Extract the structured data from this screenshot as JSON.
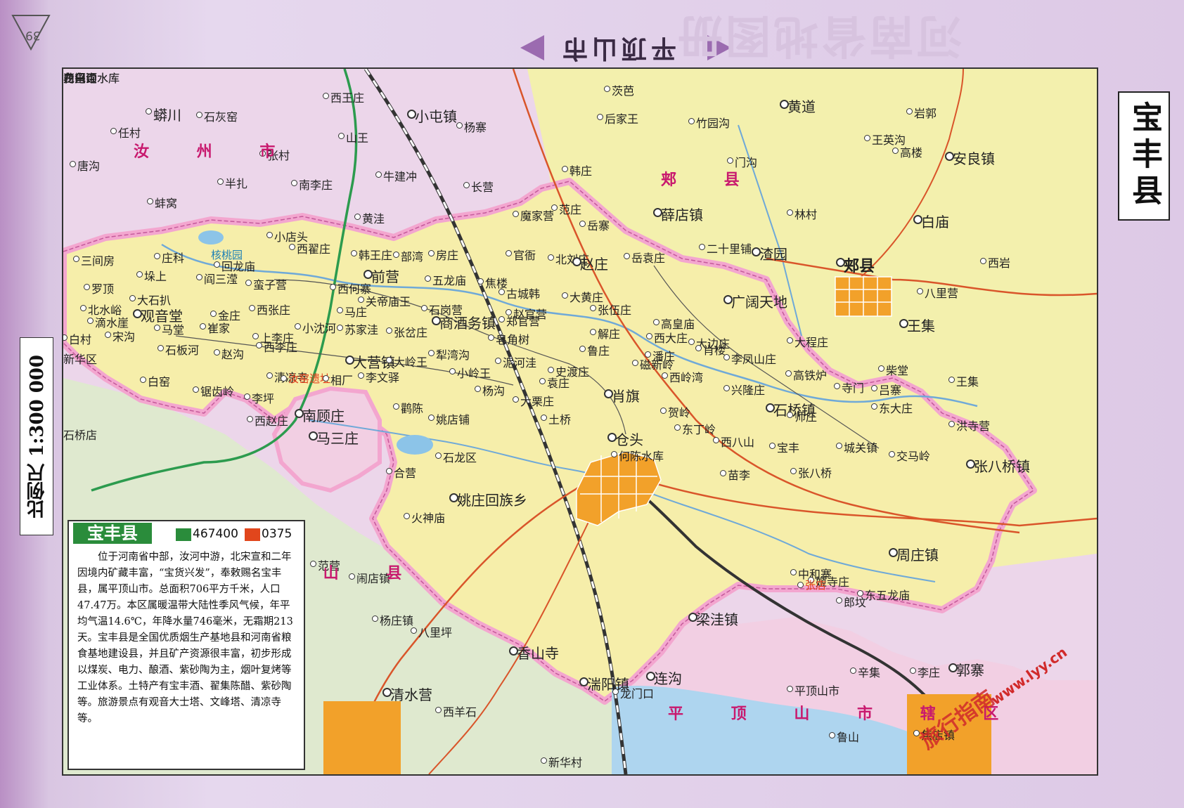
{
  "page": {
    "number": "39"
  },
  "header": {
    "city_title": "平顶山市",
    "atlas_title": "河南省地图册",
    "county_title": "宝丰县",
    "scale": "比例尺 1:300 000"
  },
  "info": {
    "name": "宝丰县",
    "area": "467400",
    "code": "0375",
    "text": "位于河南省中部，汝河中游，北宋宣和二年因境内矿藏丰富，“宝货兴发”，奉敕赐名宝丰县，属平顶山市。总面积706平方千米，人口47.47万。本区属暖温带大陆性季风气候，年平均气温14.6℃，年降水量746毫米，无霜期213天。宝丰县是全国优质烟生产基地县和河南省粮食基地建设县，并且矿产资源很丰富，初步形成以煤炭、电力、酿酒、紫砂陶为主，烟叶复烤等工业体系。土特产有宝丰酒、翟集陈醋、紫砂陶等。旅游景点有观音大士塔、文峰塔、清凉寺等。"
  },
  "colors": {
    "county": "#f6eeaa",
    "jia": "#f3f0ad",
    "pds": "#f2cfe3",
    "lu": "#dfe9cf",
    "ruzhou": "#ecd6ea",
    "border": "#f3a6cf",
    "river": "#6fa9d8",
    "road": "#d9552a",
    "rail": "#333333",
    "urban": "#f2a12a"
  },
  "watermark": {
    "text": "旅行指南",
    "url": "www.lyy.cn"
  },
  "regions": {
    "ruzhou": "汝 州 市",
    "jiaxian": "郏 县",
    "lushan": "鲁 山 县",
    "pds": "平 顶 山 市 辖 区"
  },
  "places": [
    {
      "n": "蟒川"
    },
    {
      "n": "石灰窑"
    },
    {
      "n": "任村"
    },
    {
      "n": "西王庄"
    },
    {
      "n": "小屯镇"
    },
    {
      "n": "茨芭"
    },
    {
      "n": "黄道"
    },
    {
      "n": "岩郭"
    },
    {
      "n": "安良镇"
    },
    {
      "n": "唐沟"
    },
    {
      "n": "张村"
    },
    {
      "n": "杨寨"
    },
    {
      "n": "后家王"
    },
    {
      "n": "竹园沟"
    },
    {
      "n": "王英沟"
    },
    {
      "n": "高楼"
    },
    {
      "n": "山王"
    },
    {
      "n": "门沟"
    },
    {
      "n": "半扎"
    },
    {
      "n": "南李庄"
    },
    {
      "n": "牛建冲"
    },
    {
      "n": "长营"
    },
    {
      "n": "韩庄"
    },
    {
      "n": "林村"
    },
    {
      "n": "薛店镇"
    },
    {
      "n": "白庙"
    },
    {
      "n": "蚌窝"
    },
    {
      "n": "黄洼"
    },
    {
      "n": "魔家营"
    },
    {
      "n": "范庄"
    },
    {
      "n": "岳寨"
    },
    {
      "n": "二十里铺"
    },
    {
      "n": "渣园"
    },
    {
      "n": "郏县"
    },
    {
      "n": "西岩"
    },
    {
      "n": "三间房"
    },
    {
      "n": "庄科"
    },
    {
      "n": "小店头"
    },
    {
      "n": "西翟庄"
    },
    {
      "n": "韩王庄"
    },
    {
      "n": "部湾"
    },
    {
      "n": "房庄"
    },
    {
      "n": "官衙"
    },
    {
      "n": "北刘庄"
    },
    {
      "n": "赵庄"
    },
    {
      "n": "岳袁庄"
    },
    {
      "n": "罗顶"
    },
    {
      "n": "垛上"
    },
    {
      "n": "回龙庙"
    },
    {
      "n": "前营"
    },
    {
      "n": "五龙庙"
    },
    {
      "n": "八里营"
    },
    {
      "n": "北水峪"
    },
    {
      "n": "大石扒"
    },
    {
      "n": "观音堂"
    },
    {
      "n": "阎三滢"
    },
    {
      "n": "蛮子营"
    },
    {
      "n": "西何寨"
    },
    {
      "n": "关帝庙王"
    },
    {
      "n": "焦楼"
    },
    {
      "n": "古城韩"
    },
    {
      "n": "大黄庄"
    },
    {
      "n": "广阔天地"
    },
    {
      "n": "王集"
    },
    {
      "n": "滴水崖"
    },
    {
      "n": "金庄"
    },
    {
      "n": "西张庄"
    },
    {
      "n": "马庄"
    },
    {
      "n": "石岗营"
    },
    {
      "n": "赵官营"
    },
    {
      "n": "张伍庄"
    },
    {
      "n": "高皇庙"
    },
    {
      "n": "大程庄"
    },
    {
      "n": "宋沟"
    },
    {
      "n": "马堂"
    },
    {
      "n": "崔家"
    },
    {
      "n": "小沈河"
    },
    {
      "n": "商酒务镇"
    },
    {
      "n": "郑官营"
    },
    {
      "n": "解庄"
    },
    {
      "n": "西大庄"
    },
    {
      "n": "大边庄"
    },
    {
      "n": "石板河"
    },
    {
      "n": "上李庄"
    },
    {
      "n": "苏家洼"
    },
    {
      "n": "张岔庄"
    },
    {
      "n": "皂角树"
    },
    {
      "n": "鲁庄"
    },
    {
      "n": "磁新岭"
    },
    {
      "n": "肖楼"
    },
    {
      "n": "李凤山庄"
    },
    {
      "n": "柴堂"
    },
    {
      "n": "赵沟"
    },
    {
      "n": "西李庄"
    },
    {
      "n": "大营镇"
    },
    {
      "n": "大岭王"
    },
    {
      "n": "犁湾沟"
    },
    {
      "n": "泥河洼"
    },
    {
      "n": "史渡庄"
    },
    {
      "n": "潘庄"
    },
    {
      "n": "西岭湾"
    },
    {
      "n": "高铁炉"
    },
    {
      "n": "寺门"
    },
    {
      "n": "吕寨"
    },
    {
      "n": "王集"
    },
    {
      "n": "白窑"
    },
    {
      "n": "清凉寺"
    },
    {
      "n": "汝窑遗址"
    },
    {
      "n": "相厂"
    },
    {
      "n": "李文驿"
    },
    {
      "n": "小岭王"
    },
    {
      "n": "杨沟"
    },
    {
      "n": "袁庄"
    },
    {
      "n": "肖旗"
    },
    {
      "n": "兴隆庄"
    },
    {
      "n": "石桥镇"
    },
    {
      "n": "东大庄"
    },
    {
      "n": "锯齿岭"
    },
    {
      "n": "李坪"
    },
    {
      "n": "西赵庄"
    },
    {
      "n": "南顾庄"
    },
    {
      "n": "鹳陈"
    },
    {
      "n": "姚店铺"
    },
    {
      "n": "大栗庄"
    },
    {
      "n": "土桥"
    },
    {
      "n": "贺岭"
    },
    {
      "n": "东丁岭"
    },
    {
      "n": "师庄"
    },
    {
      "n": "洪寺营"
    },
    {
      "n": "石桥店"
    },
    {
      "n": "马三庄"
    },
    {
      "n": "石龙区"
    },
    {
      "n": "仓头"
    },
    {
      "n": "何陈水库"
    },
    {
      "n": "西八山"
    },
    {
      "n": "宝丰"
    },
    {
      "n": "城关镇"
    },
    {
      "n": "交马岭"
    },
    {
      "n": "合营"
    },
    {
      "n": "火神庙"
    },
    {
      "n": "姚庄回族乡"
    },
    {
      "n": "苗李"
    },
    {
      "n": "张八桥"
    },
    {
      "n": "张八桥镇"
    },
    {
      "n": "周庄镇"
    },
    {
      "n": "中和寨"
    },
    {
      "n": "东五龙庙"
    },
    {
      "n": "范营"
    },
    {
      "n": "闹店镇"
    },
    {
      "n": "梁洼镇"
    },
    {
      "n": "杨庄镇"
    },
    {
      "n": "姬寺庄"
    },
    {
      "n": "郎坟"
    },
    {
      "n": "八里坪"
    },
    {
      "n": "香山寺"
    },
    {
      "n": "李庄"
    },
    {
      "n": "龙门口"
    },
    {
      "n": "连沟"
    },
    {
      "n": "辛集"
    },
    {
      "n": "湍阳镇"
    },
    {
      "n": "郭寨"
    },
    {
      "n": "张店"
    },
    {
      "n": "清水营"
    },
    {
      "n": "西羊石"
    },
    {
      "n": "平顶山市"
    },
    {
      "n": "焦店镇"
    },
    {
      "n": "新华村"
    },
    {
      "n": "鲁山"
    },
    {
      "n": "核桃园"
    },
    {
      "n": "白村"
    },
    {
      "n": "新华区"
    },
    {
      "n": "白龟山水库"
    },
    {
      "n": "龙兴寺水库"
    },
    {
      "n": "药皇顶"
    },
    {
      "n": "石门沟"
    }
  ]
}
